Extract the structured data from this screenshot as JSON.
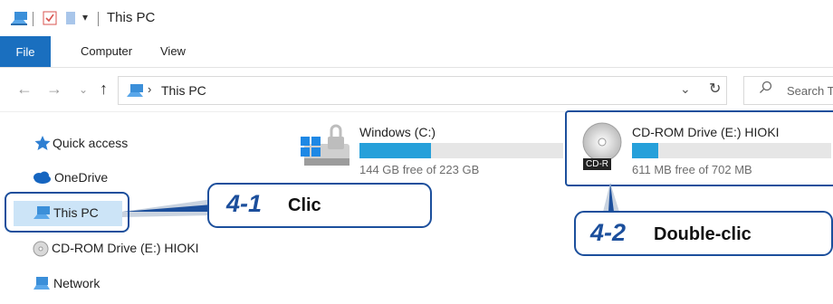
{
  "window": {
    "title": "This PC"
  },
  "ribbon": {
    "tabs": [
      "File",
      "Computer",
      "View"
    ]
  },
  "address": {
    "path_label": "This PC",
    "search_placeholder": "Search T"
  },
  "sidebar": {
    "items": [
      {
        "label": "Quick access"
      },
      {
        "label": "OneDrive"
      },
      {
        "label": "This PC"
      },
      {
        "label": "CD-ROM Drive (E:) HIOKI"
      },
      {
        "label": "Network"
      }
    ]
  },
  "drives": [
    {
      "name": "Windows (C:)",
      "free": "144 GB free of 223 GB",
      "used_fraction": 0.35
    },
    {
      "name": "CD-ROM Drive (E:) HIOKI",
      "free": "611 MB free of 702 MB",
      "badge": "CD-R",
      "used_fraction": 0.13
    }
  ],
  "callouts": [
    {
      "number": "4-1",
      "text": "Clic"
    },
    {
      "number": "4-2",
      "text": "Double-clic"
    }
  ],
  "colors": {
    "accent": "#1a6fbf",
    "callout": "#1c4f9c",
    "bar": "#26a0da"
  }
}
